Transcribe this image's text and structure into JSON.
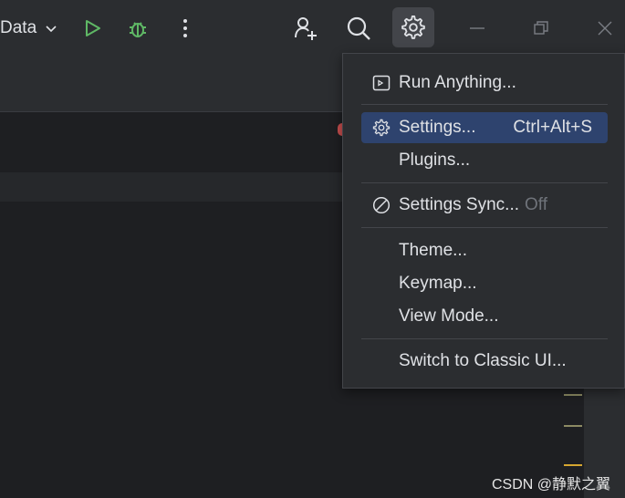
{
  "toolbar": {
    "config_label": "Data",
    "icons": [
      "chevron-down-icon",
      "run-icon",
      "debug-icon",
      "more-icon",
      "add-user-icon",
      "search-icon",
      "gear-icon",
      "minimize-icon",
      "restore-icon",
      "close-icon"
    ]
  },
  "menu": {
    "items": [
      {
        "label": "Run Anything...",
        "icon": "run-anything-icon"
      },
      {
        "label": "Settings...",
        "icon": "gear-icon",
        "shortcut": "Ctrl+Alt+S",
        "selected": true
      },
      {
        "label": "Plugins..."
      },
      {
        "label": "Settings Sync...",
        "icon": "no-sync-icon",
        "status": "Off"
      },
      {
        "label": "Theme..."
      },
      {
        "label": "Keymap..."
      },
      {
        "label": "View Mode..."
      },
      {
        "label": "Switch to Classic UI..."
      }
    ]
  },
  "colors": {
    "selected_bg": "#2e436e",
    "run_green": "#5fb865",
    "marker_olive": "#8c8a63",
    "marker_yellow": "#d6a630"
  },
  "watermark": "CSDN @静默之翼"
}
